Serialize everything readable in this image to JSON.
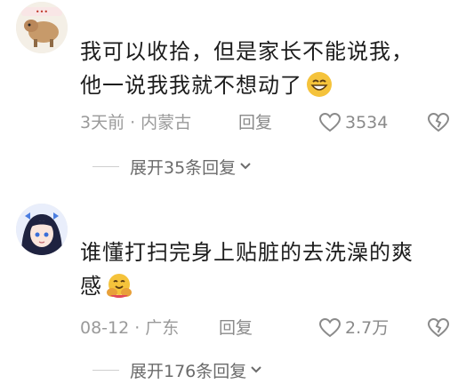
{
  "comments": [
    {
      "text_line1": "我可以收拾，但是家长不能说我，",
      "text_line2": "他一说我我就不想动了",
      "date": "3天前",
      "location": "内蒙古",
      "reply_label": "回复",
      "like_count": "3534",
      "expand_label": "展开35条回复",
      "emoji": "grinning-face-emoji",
      "avatar": "cartoon-animal-avatar"
    },
    {
      "text_line1": "谁懂打扫完身上贴脏的去洗澡的爽",
      "text_line2": "感",
      "date": "08-12",
      "location": "广东",
      "reply_label": "回复",
      "like_count": "2.7万",
      "expand_label": "展开176条回复",
      "emoji": "hugging-face-emoji",
      "avatar": "anime-girl-avatar"
    }
  ],
  "colors": {
    "text": "#1c1c1c",
    "meta": "#9a9a9a",
    "icon": "#8a8a8a",
    "emoji_yellow": "#f5c33b"
  },
  "separator": "·"
}
